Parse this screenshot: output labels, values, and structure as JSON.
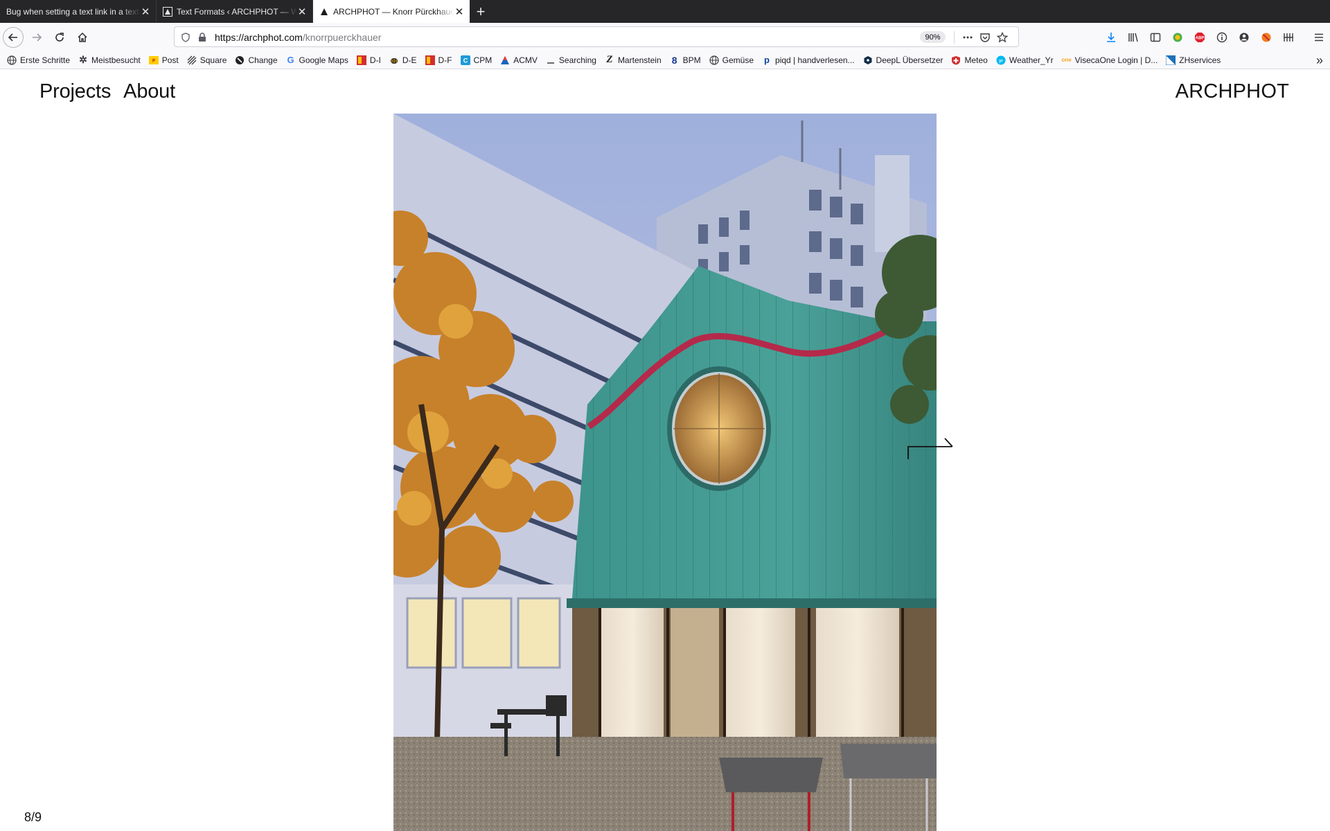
{
  "browser": {
    "tabs": [
      {
        "title": "Bug when setting a text link in a text",
        "active": false
      },
      {
        "title": "Text Formats ‹ ARCHPHOT — W",
        "active": false
      },
      {
        "title": "ARCHPHOT — Knorr Pürckhauer",
        "active": true
      }
    ],
    "url": {
      "host": "https://archphot.com",
      "path": "/knorrpuerckhauer"
    },
    "zoom": "90%",
    "bookmarks": [
      {
        "label": "Erste Schritte",
        "icon": "globe-icon"
      },
      {
        "label": "Meistbesucht",
        "icon": "gear-icon"
      },
      {
        "label": "Post",
        "icon": "post-icon"
      },
      {
        "label": "Square",
        "icon": "square-icon"
      },
      {
        "label": "Change",
        "icon": "change-icon"
      },
      {
        "label": "Google Maps",
        "icon": "google-icon"
      },
      {
        "label": "D-I",
        "icon": "flag-icon"
      },
      {
        "label": "D-E",
        "icon": "bee-icon"
      },
      {
        "label": "D-F",
        "icon": "flag-icon"
      },
      {
        "label": "CPM",
        "icon": "c-icon"
      },
      {
        "label": "ACMV",
        "icon": "acmv-icon"
      },
      {
        "label": "Searching",
        "icon": "dash-icon"
      },
      {
        "label": "Martenstein",
        "icon": "z-icon"
      },
      {
        "label": "BPM",
        "icon": "b-icon"
      },
      {
        "label": "Gemüse",
        "icon": "globe-icon"
      },
      {
        "label": "piqd | handverlesen...",
        "icon": "piqd-icon"
      },
      {
        "label": "DeepL Übersetzer",
        "icon": "deepl-icon"
      },
      {
        "label": "Meteo",
        "icon": "swiss-icon"
      },
      {
        "label": "Weather_Yr",
        "icon": "yr-icon"
      },
      {
        "label": "VisecaOne Login | D...",
        "icon": "one-icon"
      },
      {
        "label": "ZHservices",
        "icon": "zh-icon"
      }
    ]
  },
  "site": {
    "nav": {
      "projects": "Projects",
      "about": "About"
    },
    "logo": "ARCHPHOT",
    "counter": "8/9"
  },
  "colors": {
    "tab_strip": "#262628",
    "toolbar": "#f9f9fb",
    "cladding": "#3f9a92",
    "window_frame": "#b5294a",
    "autumn_leaves": "#d08a2a"
  }
}
